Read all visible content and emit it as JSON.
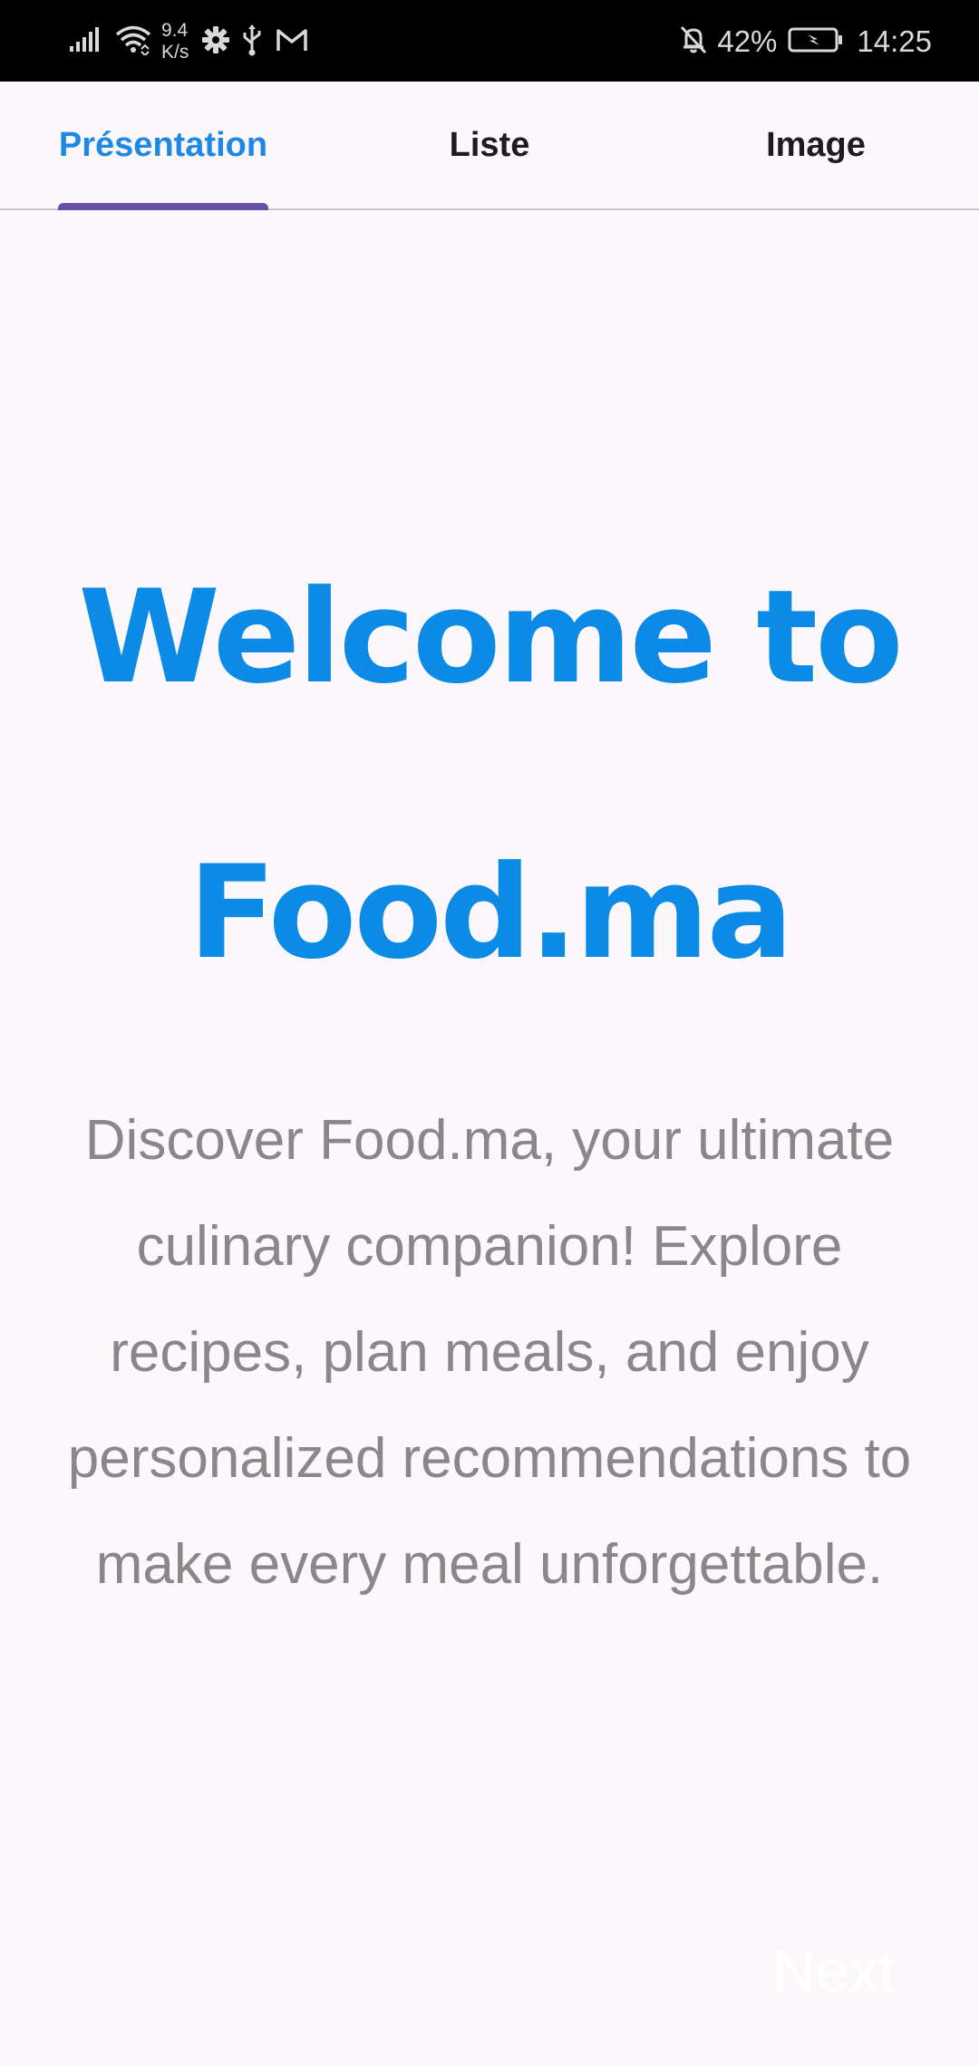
{
  "status_bar": {
    "net_speed_value": "9.4",
    "net_speed_unit": "K/s",
    "battery_percent": "42%",
    "time": "14:25",
    "icons": [
      "signal-icon",
      "wifi-icon",
      "settings-icon",
      "usb-icon",
      "gmail-icon",
      "mute-bell-icon",
      "battery-charging-icon"
    ]
  },
  "tabs": [
    {
      "label": "Présentation",
      "active": true
    },
    {
      "label": "Liste",
      "active": false
    },
    {
      "label": "Image",
      "active": false
    }
  ],
  "main": {
    "title_line1": "Welcome to",
    "title_line2": "Food.ma",
    "description": "Discover Food.ma, your ultimate culinary companion! Explore recipes, plan meals, and enjoy personalized recommendations to make every meal unforgettable.",
    "next_label": "Next"
  },
  "colors": {
    "accent": "#0b8be6",
    "tab_indicator": "#6750a4",
    "description_text": "#8a8689",
    "background": "#fcf7fb"
  }
}
